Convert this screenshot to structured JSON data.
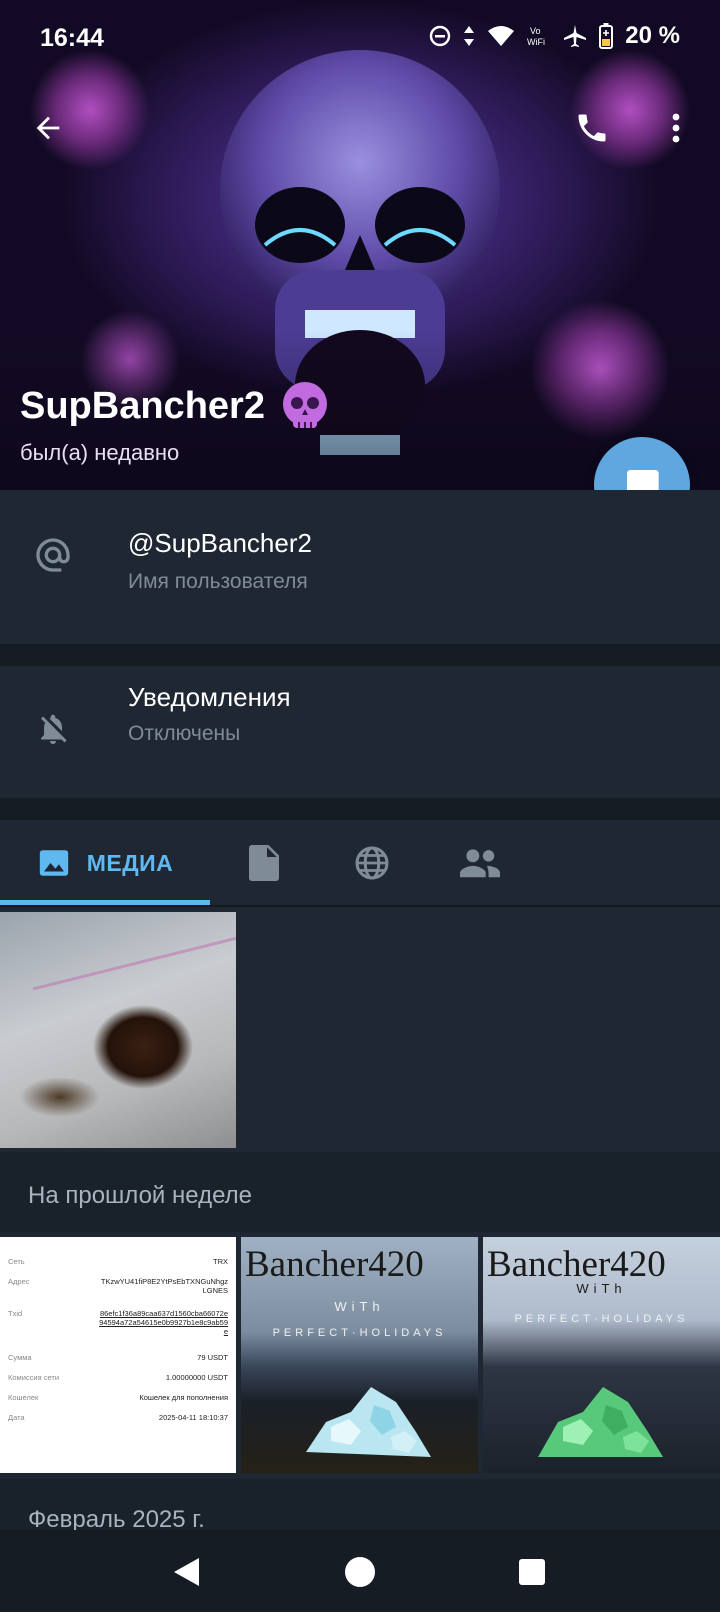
{
  "status_bar": {
    "time": "16:44",
    "battery_percent": "20 %",
    "vowifi_label": "Vo WiFi"
  },
  "toolbar": {
    "back_icon": "arrow-left-icon",
    "call_icon": "phone-icon",
    "more_icon": "more-vertical-icon"
  },
  "profile": {
    "name": "SupBancher2",
    "status": "был(а) недавно",
    "emoji": "skull-emoji"
  },
  "info": {
    "username": "@SupBancher2",
    "username_label": "Имя пользователя",
    "notifications_title": "Уведомления",
    "notifications_value": "Отключены"
  },
  "tabs": {
    "media_label": "МЕДИА",
    "items": [
      "media-icon",
      "file-icon",
      "globe-icon",
      "people-icon"
    ],
    "active": "media"
  },
  "media": {
    "section_last_week": "На прошлой неделе",
    "section_feb": "Февраль 2025 г."
  },
  "receipt": {
    "rows": [
      {
        "k": "Сеть",
        "v": "TRX"
      },
      {
        "k": "Адрес",
        "v": "TKzwYU41fiP8E2YtPsEbTXNGuNhgzLGNES"
      },
      {
        "k": "Txid",
        "v": "86efc1f36a89caa637d1560cba66072e94594a72a54615e0b9927b1e8c9ab59e"
      },
      {
        "k": "Сумма",
        "v": "79 USDT"
      },
      {
        "k": "Комиссия сети",
        "v": "1.00000000 USDT"
      },
      {
        "k": "Кошелек",
        "v": "Кошелек для пополнения"
      },
      {
        "k": "Дата",
        "v": "2025-04-11 18:10:37"
      }
    ]
  },
  "brand_photos": {
    "title": "Bancher420",
    "with": "WiTh",
    "tagline": "PERFECT·HOLIDAYS"
  },
  "colors": {
    "accent": "#5fb8ef",
    "fab": "#5fa7de",
    "background": "#1f2832"
  }
}
